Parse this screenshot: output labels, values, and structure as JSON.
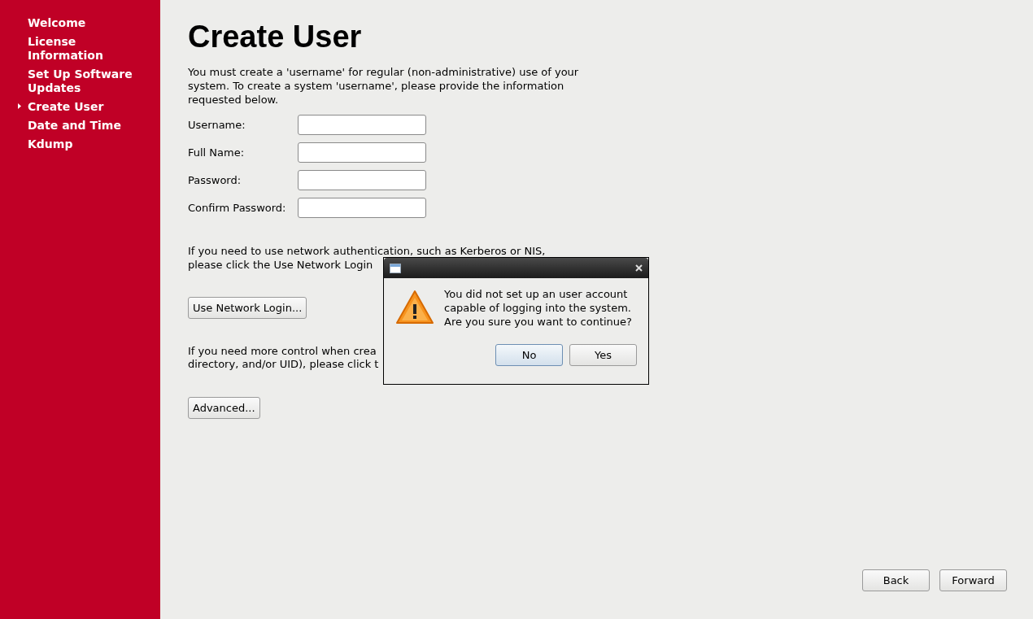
{
  "sidebar": {
    "items": [
      {
        "label": "Welcome",
        "selected": false
      },
      {
        "label": "License Information",
        "selected": false
      },
      {
        "label": "Set Up Software Updates",
        "selected": false
      },
      {
        "label": "Create User",
        "selected": true
      },
      {
        "label": "Date and Time",
        "selected": false
      },
      {
        "label": "Kdump",
        "selected": false
      }
    ]
  },
  "title": "Create User",
  "intro": "You must create a 'username' for regular (non-administrative) use of your system.  To create a system 'username', please provide the information requested below.",
  "fields": [
    {
      "label": "Username:"
    },
    {
      "label": "Full Name:"
    },
    {
      "label": "Password:"
    },
    {
      "label": "Confirm Password:"
    }
  ],
  "network_text": [
    "If you need to use network authentication, such as Kerberos or NIS,",
    "please click the Use Network Login"
  ],
  "network_button": "Use Network Login...",
  "advanced_text": [
    "If you need more control when crea",
    "directory, and/or UID), please click t"
  ],
  "advanced_button": "Advanced...",
  "nav_buttons": [
    "Back",
    "Forward"
  ],
  "dialog": {
    "message": "You did not set up an user account capable of logging into the system. Are you sure you want to continue?",
    "buttons": [
      {
        "label": "No",
        "selected": true
      },
      {
        "label": "Yes",
        "selected": false
      }
    ]
  }
}
